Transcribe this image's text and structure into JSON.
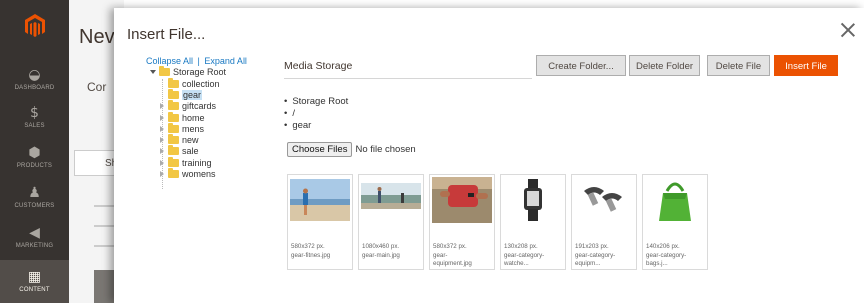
{
  "sidebar": {
    "items": [
      {
        "icon": "dashboard-icon",
        "label": "DASHBOARD",
        "glyph": "◒"
      },
      {
        "icon": "dollar-icon",
        "label": "SALES",
        "glyph": "$"
      },
      {
        "icon": "cube-icon",
        "label": "PRODUCTS",
        "glyph": "⬢"
      },
      {
        "icon": "person-icon",
        "label": "CUSTOMERS",
        "glyph": "♟"
      },
      {
        "icon": "megaphone-icon",
        "label": "MARKETING",
        "glyph": "◀"
      },
      {
        "icon": "layout-icon",
        "label": "CONTENT",
        "glyph": "▦"
      }
    ]
  },
  "background_page": {
    "title": "Nev",
    "subtitle": "Cor",
    "switch_label": "Sh"
  },
  "modal": {
    "title": "Insert File...",
    "tree": {
      "collapse_all": "Collapse All",
      "separator": "|",
      "expand_all": "Expand All",
      "root": "Storage Root",
      "folders": [
        "collection",
        "gear",
        "giftcards",
        "home",
        "mens",
        "new",
        "sale",
        "training",
        "womens"
      ],
      "selected": "gear"
    },
    "content": {
      "storage_title": "Media Storage",
      "buttons": {
        "create_folder": "Create Folder...",
        "delete_folder": "Delete Folder",
        "delete_file": "Delete File",
        "insert_file": "Insert File"
      },
      "path": [
        "Storage Root",
        "/",
        "gear"
      ],
      "choose_files": "Choose Files",
      "no_file": "No file chosen",
      "files": [
        {
          "dims": "580x372 px.",
          "name": "gear-fitnes.jpg",
          "name2": ""
        },
        {
          "dims": "1080x460 px.",
          "name": "gear-main.jpg",
          "name2": ""
        },
        {
          "dims": "580x372 px.",
          "name": "gear-",
          "name2": "equipment.jpg"
        },
        {
          "dims": "130x208 px.",
          "name": "gear-category-",
          "name2": "watche..."
        },
        {
          "dims": "191x203 px.",
          "name": "gear-category-",
          "name2": "equipm..."
        },
        {
          "dims": "140x206 px.",
          "name": "gear-category-",
          "name2": "bags.j..."
        }
      ]
    }
  },
  "colors": {
    "sidebar_bg": "#373330",
    "accent": "#eb5202",
    "link": "#1979c3",
    "folder": "#f2c744"
  }
}
